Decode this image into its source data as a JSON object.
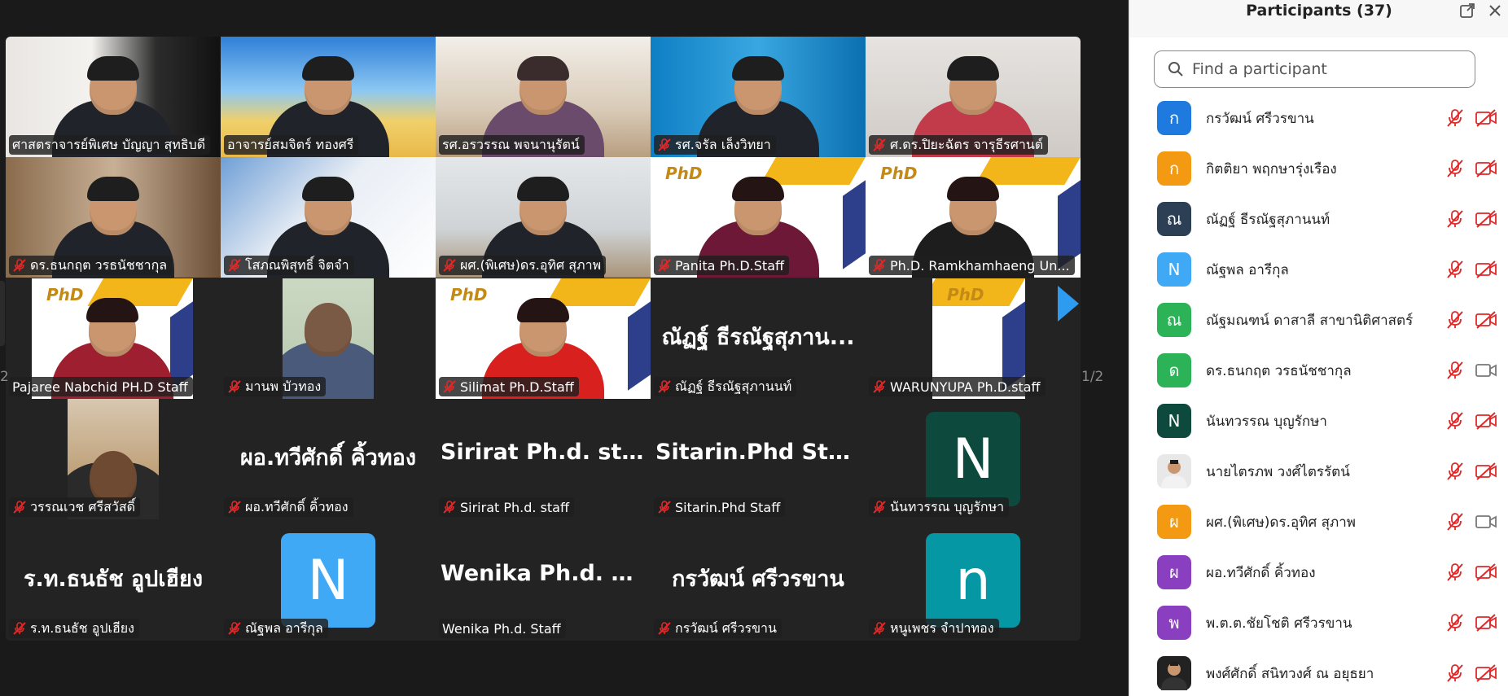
{
  "gallery": {
    "page_indicator": "1/2",
    "page_indicator_left": "2",
    "rows": [
      [
        {
          "name": "ศาสตราจารย์พิเศษ บัญญา สุทธิบดี",
          "muted": false,
          "kind": "video",
          "bg": "office"
        },
        {
          "name": "อาจารย์สมจิตร์ ทองศรี",
          "muted": false,
          "kind": "video",
          "bg": "beach",
          "active": true
        },
        {
          "name": "รศ.อรวรรณ พจนานุรัตน์",
          "muted": false,
          "kind": "video",
          "bg": "room"
        },
        {
          "name": "รศ.จรัล เล็งวิทยา",
          "muted": true,
          "kind": "video",
          "bg": "blue"
        },
        {
          "name": "ศ.ดร.ปิยะฉัตร จารุธีรศานต์",
          "muted": true,
          "kind": "video",
          "bg": "plain"
        }
      ],
      [
        {
          "name": "ดร.ธนกฤต วรธนัชชากุล",
          "muted": true,
          "kind": "video",
          "bg": "library"
        },
        {
          "name": "โสภณพิสุทธิ์ จิตจำ",
          "muted": true,
          "kind": "video",
          "bg": "phdblue"
        },
        {
          "name": "ผศ.(พิเศษ)ดร.อุทิศ สุภาพ",
          "muted": true,
          "kind": "video",
          "bg": "desk"
        },
        {
          "name": "Panita Ph.D.Staff",
          "muted": true,
          "kind": "video",
          "bg": "phd"
        },
        {
          "name": "Ph.D. Ramkhamhaeng Un...",
          "muted": true,
          "kind": "video",
          "bg": "phd"
        }
      ],
      [
        {
          "name": "Pajaree Nabchid PH.D Staff",
          "muted": false,
          "kind": "video",
          "bg": "phdsmall"
        },
        {
          "name": "มานพ บัวทอง",
          "muted": true,
          "kind": "video",
          "bg": "greenwall"
        },
        {
          "name": "Silimat Ph.D.Staff",
          "muted": true,
          "kind": "video",
          "bg": "phd"
        },
        {
          "name": "ณัฏฐ์ ธีรณัฐสุภานนท์",
          "muted": true,
          "kind": "text",
          "big": "ณัฏฐ์ ธีรณัฐสุภาน..."
        },
        {
          "name": "WARUNYUPA Ph.D.staff",
          "muted": true,
          "kind": "video",
          "bg": "phdnarrow"
        }
      ],
      [
        {
          "name": "วรรณเวช ศรีสวัสดิ์",
          "muted": true,
          "kind": "video",
          "bg": "darkroom"
        },
        {
          "name": "ผอ.ทวีศักดิ์ คิ้วทอง",
          "muted": true,
          "kind": "text",
          "big": "ผอ.ทวีศักดิ์ คิ้วทอง"
        },
        {
          "name": "Sirirat Ph.d. staff",
          "muted": true,
          "kind": "text",
          "big": "Sirirat Ph.d. staff"
        },
        {
          "name": "Sitarin.Phd Staff",
          "muted": true,
          "kind": "text",
          "big": "Sitarin.Phd Staff"
        },
        {
          "name": "นันทวรรณ บุญรักษา",
          "muted": true,
          "kind": "avatar",
          "letter": "N",
          "color": "#0d4a3d"
        }
      ],
      [
        {
          "name": "ร.ท.ธนธัช อูปเฮียง",
          "muted": true,
          "kind": "text",
          "big": "ร.ท.ธนธัช อูปเฮียง"
        },
        {
          "name": "ณัฐพล อารีกุล",
          "muted": true,
          "kind": "avatar",
          "letter": "N",
          "color": "#3fa9f5"
        },
        {
          "name": "Wenika Ph.d. Staff",
          "muted": false,
          "kind": "text",
          "big": "Wenika Ph.d. St..."
        },
        {
          "name": "กรวัฒน์ ศรีวรขาน",
          "muted": true,
          "kind": "text",
          "big": "กรวัฒน์ ศรีวรขาน"
        },
        {
          "name": "หนูเพชร จำปาทอง",
          "muted": true,
          "kind": "avatar",
          "letter": "n",
          "color": "#0597a3"
        }
      ]
    ]
  },
  "panel": {
    "title": "Participants (37)",
    "search_placeholder": "Find a participant",
    "participants": [
      {
        "name": "กรวัฒน์ ศรีวรขาน",
        "initial": "ก",
        "color": "#1f7ae0",
        "cam": "off"
      },
      {
        "name": "กิตติยา พฤกษารุ่งเรือง",
        "initial": "ก",
        "color": "#f39a12",
        "cam": "off"
      },
      {
        "name": "ณัฏฐ์ ธีรณัฐสุภานนท์",
        "initial": "ณ",
        "color": "#2d3f55",
        "cam": "off"
      },
      {
        "name": "ณัฐพล อารีกุล",
        "initial": "N",
        "color": "#3fa9f5",
        "cam": "off"
      },
      {
        "name": "ณัฐมณฑน์ ดาสาลี สาขานิติศาสตร์",
        "initial": "ณ",
        "color": "#2db357",
        "cam": "off"
      },
      {
        "name": "ดร.ธนกฤต วรธนัชชากุล",
        "initial": "ด",
        "color": "#2db357",
        "cam": "on"
      },
      {
        "name": "นันทวรรณ บุญรักษา",
        "initial": "N",
        "color": "#0d4a3d",
        "cam": "off"
      },
      {
        "name": "นายไตรภพ วงศ์ไตรรัตน์",
        "initial": "",
        "color": "#e8e8e8",
        "cam": "off",
        "photo": true
      },
      {
        "name": "ผศ.(พิเศษ)ดร.อุทิศ สุภาพ",
        "initial": "ผ",
        "color": "#f39a12",
        "cam": "on"
      },
      {
        "name": "ผอ.ทวีศักดิ์ คิ้วทอง",
        "initial": "ผ",
        "color": "#8a3fc0",
        "cam": "off"
      },
      {
        "name": "พ.ต.ต.ชัยโชติ ศรีวรขาน",
        "initial": "พ",
        "color": "#8a3fc0",
        "cam": "off"
      },
      {
        "name": "พงศ์ศักดิ์ สนิทวงศ์ ณ อยุธยา",
        "initial": "",
        "color": "#222",
        "cam": "off",
        "photo": true
      }
    ]
  },
  "colors": {
    "active_border": "#23d959",
    "muted_red": "#e02828",
    "accent_blue": "#2d9cf0"
  }
}
